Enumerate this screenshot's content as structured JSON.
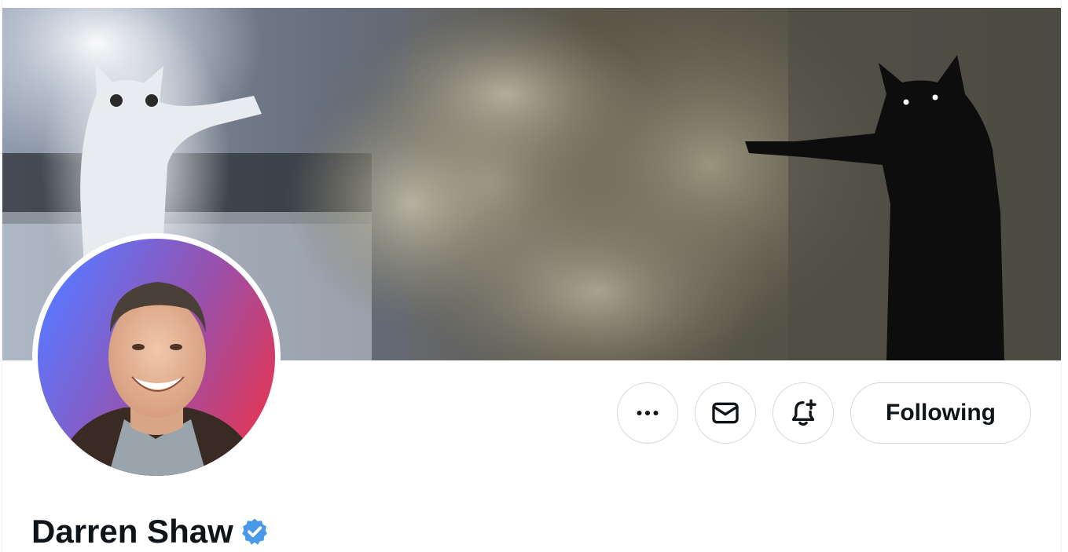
{
  "profile": {
    "display_name": "Darren Shaw",
    "verified": true,
    "verified_icon": "verified-badge-icon",
    "banner_description_icon": "cat-banner-image",
    "avatar_icon": "profile-photo"
  },
  "actions": {
    "more_icon": "ellipsis-icon",
    "message_icon": "envelope-icon",
    "notify_icon": "bell-plus-icon",
    "follow_label": "Following"
  },
  "colors": {
    "text": "#0f1419",
    "border": "#cfd9de",
    "verified": "#4a99e9",
    "avatar_gradient_start": "#5a78ff",
    "avatar_gradient_end": "#e8344f"
  }
}
